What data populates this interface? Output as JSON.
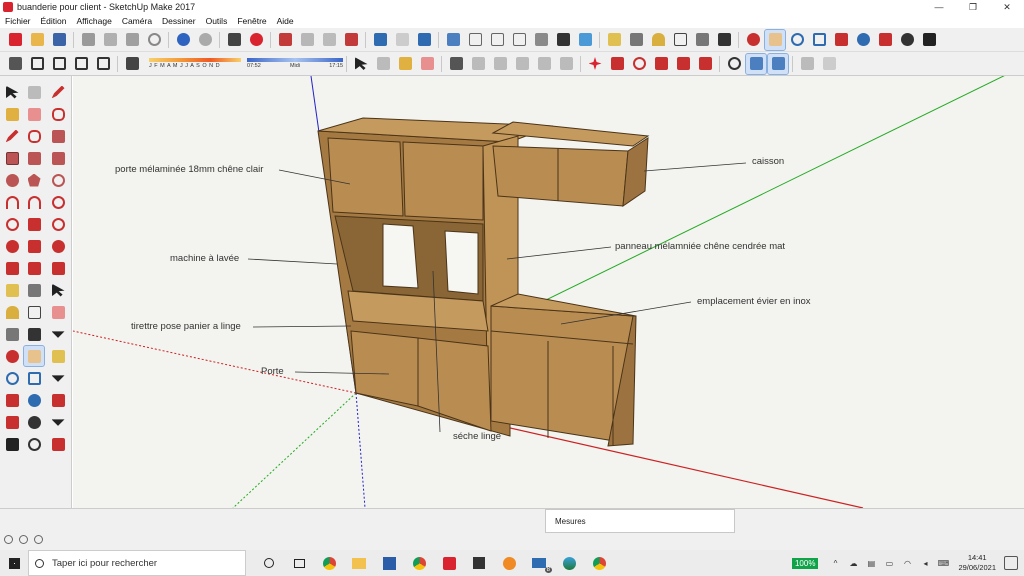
{
  "window": {
    "title": "buanderie pour client - SketchUp Make 2017",
    "controls": [
      "—",
      "❐",
      "✕"
    ]
  },
  "menu": [
    "Fichier",
    "Édition",
    "Affichage",
    "Caméra",
    "Dessiner",
    "Outils",
    "Fenêtre",
    "Aide"
  ],
  "shadow": {
    "months": "J F M A M J J A S O N D",
    "time_start": "07:52",
    "time_mid": "Midi",
    "time_end": "17:15"
  },
  "annotations": {
    "porte_melaminee": "porte mélaminée 18mm chêne clair",
    "caisson": "caisson",
    "machine": "machine à lavée",
    "panneau": "panneau mélamniée chêne cendrée mat",
    "emplacement": "emplacement évier en inox",
    "tirettre": "tirettre pose panier a linge",
    "porte": "Porte",
    "seche": "séche linge"
  },
  "status": {
    "measures_label": "Mesures"
  },
  "taskbar": {
    "search_placeholder": "Taper ici pour rechercher",
    "battery": "100%",
    "time": "14:41",
    "date": "29/06/2021",
    "notif_count": "8"
  },
  "colors": {
    "wood": "#b98d52",
    "wood_dark": "#8a6636",
    "wood_light": "#cfa769",
    "axis_red": "#cc2222",
    "axis_green": "#22aa22",
    "axis_blue": "#2222cc",
    "canvas_bg": "#f3f3ef"
  }
}
